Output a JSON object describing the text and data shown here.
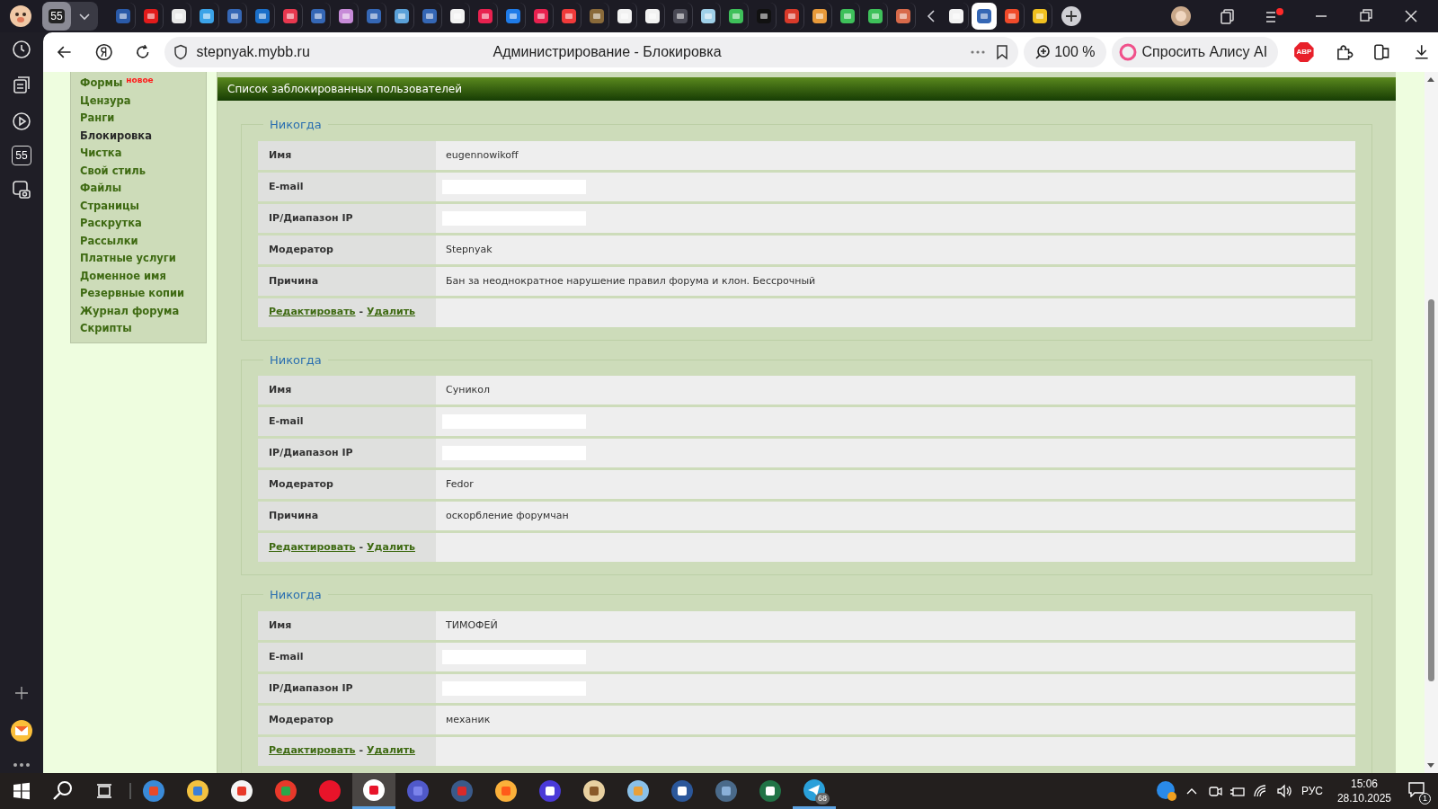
{
  "browser": {
    "tab_group": {
      "label": "55"
    },
    "tabs": [
      {
        "selected": false
      },
      {
        "selected": false
      },
      {
        "selected": false
      },
      {
        "selected": false
      },
      {
        "selected": false
      },
      {
        "selected": false
      },
      {
        "selected": false
      },
      {
        "selected": false
      },
      {
        "selected": false
      },
      {
        "selected": false
      },
      {
        "selected": false
      },
      {
        "selected": false
      },
      {
        "selected": false
      },
      {
        "selected": false
      },
      {
        "selected": false
      },
      {
        "selected": false
      },
      {
        "selected": false
      },
      {
        "selected": false
      },
      {
        "selected": false
      },
      {
        "selected": false
      },
      {
        "selected": false
      },
      {
        "selected": false
      },
      {
        "selected": false
      },
      {
        "selected": false
      },
      {
        "selected": false
      },
      {
        "selected": false
      },
      {
        "selected": false
      },
      {
        "selected": false
      },
      {
        "selected": false
      },
      {
        "selected": false
      },
      {
        "selected": true
      },
      {
        "selected": false
      },
      {
        "selected": false
      }
    ],
    "address": "stepnyak.mybb.ru",
    "page_title": "Администрирование - Блокировка",
    "zoom": "100 %",
    "assistant_button": "Спросить Алису AI",
    "adblock": "ABP",
    "side_panel_badge": "55"
  },
  "sidebar": {
    "items": [
      {
        "label": "Формы",
        "badge": "новое",
        "selected": false
      },
      {
        "label": "Цензура",
        "selected": false
      },
      {
        "label": "Ранги",
        "selected": false
      },
      {
        "label": "Блокировка",
        "selected": true
      },
      {
        "label": "Чистка",
        "selected": false
      },
      {
        "label": "Свой стиль",
        "selected": false
      },
      {
        "label": "Файлы",
        "selected": false
      },
      {
        "label": "Страницы",
        "selected": false
      },
      {
        "label": "Раскрутка",
        "selected": false
      },
      {
        "label": "Рассылки",
        "selected": false
      },
      {
        "label": "Платные услуги",
        "selected": false
      },
      {
        "label": "Доменное имя",
        "selected": false
      },
      {
        "label": "Резервные копии",
        "selected": false
      },
      {
        "label": "Журнал форума",
        "selected": false
      },
      {
        "label": "Скрипты",
        "selected": false
      }
    ]
  },
  "panel": {
    "title": "Список заблокированных пользователей",
    "bans": [
      {
        "legend": "Никогда",
        "rows": [
          {
            "kind": "text",
            "label": "Имя",
            "value": "eugennowikoff"
          },
          {
            "kind": "redacted",
            "label": "E-mail"
          },
          {
            "kind": "redacted",
            "label": "IP/Диапазон IP"
          },
          {
            "kind": "text",
            "label": "Модератор",
            "value": "Stepnyak"
          },
          {
            "kind": "text",
            "label": "Причина",
            "value": "Бан за неоднократное нарушение правил форума и клон. Бессрочный"
          }
        ],
        "edit": "Редактировать",
        "separator": "-",
        "delete": "Удалить"
      },
      {
        "legend": "Никогда",
        "rows": [
          {
            "kind": "text",
            "label": "Имя",
            "value": "Суникол"
          },
          {
            "kind": "redacted",
            "label": "E-mail"
          },
          {
            "kind": "redacted",
            "label": "IP/Диапазон IP"
          },
          {
            "kind": "text",
            "label": "Модератор",
            "value": "Fedor"
          },
          {
            "kind": "text",
            "label": "Причина",
            "value": "оскорбление форумчан"
          }
        ],
        "edit": "Редактировать",
        "separator": "-",
        "delete": "Удалить"
      },
      {
        "legend": "Никогда",
        "rows": [
          {
            "kind": "text",
            "label": "Имя",
            "value": "ТИМОФЕЙ"
          },
          {
            "kind": "redacted",
            "label": "E-mail"
          },
          {
            "kind": "redacted",
            "label": "IP/Диапазон IP"
          },
          {
            "kind": "text",
            "label": "Модератор",
            "value": "механик"
          }
        ],
        "edit": "Редактировать",
        "separator": "-",
        "delete": "Удалить"
      }
    ]
  },
  "taskbar": {
    "telegram_badge": "68",
    "language": "РУС",
    "time": "15:06",
    "date": "28.10.2025",
    "notifications": "1"
  }
}
